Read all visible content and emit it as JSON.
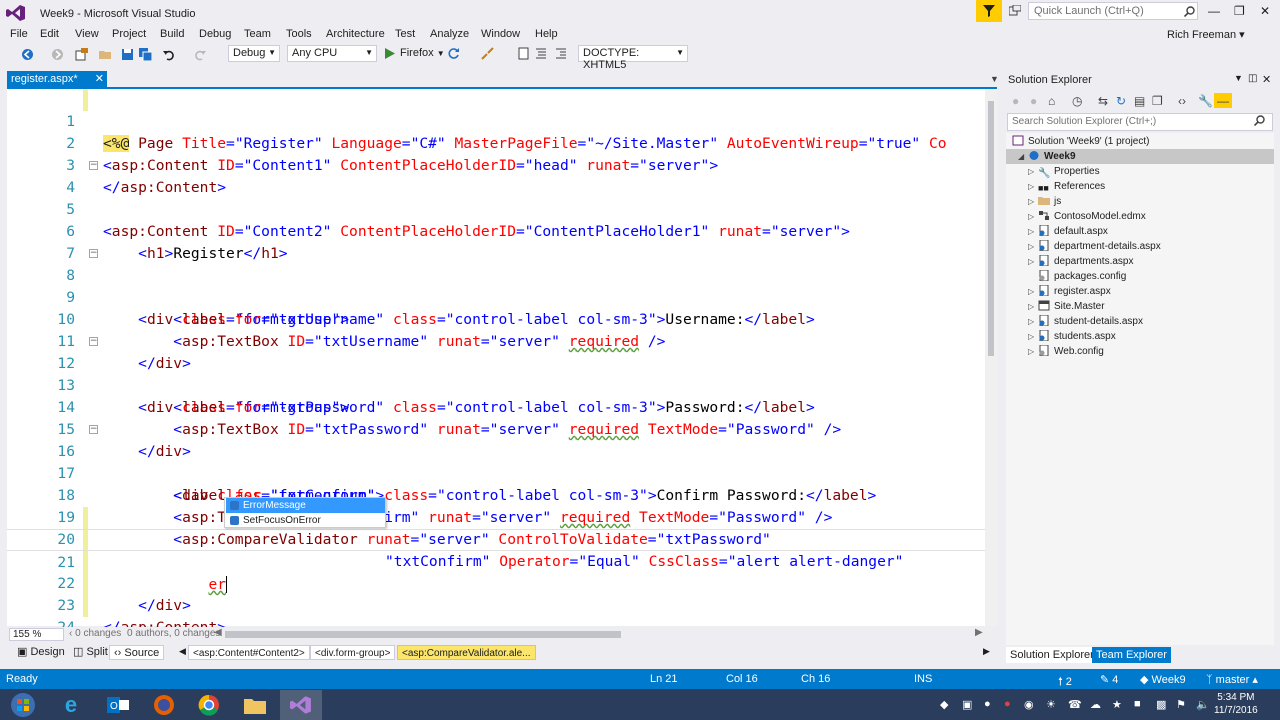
{
  "window": {
    "title": "Week9 - Microsoft Visual Studio",
    "quick_launch_placeholder": "Quick Launch (Ctrl+Q)",
    "user": "Rich Freeman"
  },
  "menu": [
    "File",
    "Edit",
    "View",
    "Project",
    "Build",
    "Debug",
    "Team",
    "Tools",
    "Architecture",
    "Test",
    "Analyze",
    "Window",
    "Help"
  ],
  "toolbar": {
    "config": "Debug",
    "platform": "Any CPU",
    "browser": "Firefox",
    "doctype": "DOCTYPE: XHTML5"
  },
  "editor": {
    "tab_label": "register.aspx*",
    "zoom": "155 %",
    "changes": "0 changes",
    "authors": "0 authors, 0 changes",
    "lines": [
      {
        "n": "1"
      },
      {
        "n": "2"
      },
      {
        "n": "3"
      },
      {
        "n": "4"
      },
      {
        "n": "5"
      },
      {
        "n": "6"
      },
      {
        "n": "7"
      },
      {
        "n": "8"
      },
      {
        "n": "9"
      },
      {
        "n": "10"
      },
      {
        "n": "11"
      },
      {
        "n": "12"
      },
      {
        "n": "13"
      },
      {
        "n": "14"
      },
      {
        "n": "15"
      },
      {
        "n": "16"
      },
      {
        "n": "17"
      },
      {
        "n": "18"
      },
      {
        "n": "19"
      },
      {
        "n": "20"
      },
      {
        "n": "21"
      },
      {
        "n": "22"
      },
      {
        "n": "23"
      },
      {
        "n": "24"
      }
    ],
    "code": {
      "l1": {
        "open": "<%@",
        "page": " Page ",
        "a1": "Title",
        "v1": "\"Register\"",
        "a2": " Language",
        "v2": "\"C#\"",
        "a3": " MasterPageFile",
        "v3": "\"~/Site.Master\"",
        "a4": " AutoEventWireup",
        "v4": "\"true\"",
        "a5": " Co"
      },
      "l2": {
        "t1": "<",
        "tag": "asp:Content",
        "a1": " ID",
        "v1": "\"Content1\"",
        "a2": " ContentPlaceHolderID",
        "v2": "\"head\"",
        "a3": " runat",
        "v3": "\"server\"",
        "t2": ">"
      },
      "l3": {
        "t1": "</",
        "tag": "asp:Content",
        "t2": ">"
      },
      "l4": {
        "t1": "<",
        "tag": "asp:Content",
        "a1": " ID",
        "v1": "\"Content2\"",
        "a2": " ContentPlaceHolderID",
        "v2": "\"ContentPlaceHolder1\"",
        "a3": " runat",
        "v3": "\"server\"",
        "t2": ">"
      },
      "l6": {
        "t1": "<",
        "tag": "h1",
        "t2": ">",
        "text": "Register",
        "t3": "</",
        "tag2": "h1",
        "t4": ">"
      },
      "l8": {
        "t1": "<",
        "tag": "div",
        "a1": " class",
        "v1": "\"form-group\"",
        "t2": ">"
      },
      "l9": {
        "t1": "<",
        "tag": "label",
        "a1": " for",
        "v1": "\"txtUsername\"",
        "a2": " class",
        "v2": "\"control-label col-sm-3\"",
        "t2": ">",
        "text": "Username:",
        "t3": "</",
        "tag2": "label",
        "t4": ">"
      },
      "l10": {
        "t1": "<",
        "tag": "asp:TextBox",
        "a1": " ID",
        "v1": "\"txtUsername\"",
        "a2": " runat",
        "v2": "\"server\"",
        "sp": " ",
        "req": "required",
        "t2": " />"
      },
      "l11": {
        "t1": "</",
        "tag": "div",
        "t2": ">"
      },
      "l12": {
        "t1": "<",
        "tag": "div",
        "a1": " class",
        "v1": "\"form-group\"",
        "t2": ">"
      },
      "l13": {
        "t1": "<",
        "tag": "label",
        "a1": " for",
        "v1": "\"txtPassword\"",
        "a2": " class",
        "v2": "\"control-label col-sm-3\"",
        "t2": ">",
        "text": "Password:",
        "t3": "</",
        "tag2": "label",
        "t4": ">"
      },
      "l14": {
        "t1": "<",
        "tag": "asp:TextBox",
        "a1": " ID",
        "v1": "\"txtPassword\"",
        "a2": " runat",
        "v2": "\"server\"",
        "sp": " ",
        "req": "required",
        "a3": " TextMode",
        "v3": "\"Password\"",
        "t2": " />"
      },
      "l15": {
        "t1": "</",
        "tag": "div",
        "t2": ">"
      },
      "l16": {
        "t1": "<",
        "tag": "div",
        "a1": " class",
        "v1": "\"form-group\"",
        "t2": ">"
      },
      "l17": {
        "t1": "<",
        "tag": "label",
        "a1": " for",
        "v1": "\"txtConfirm\"",
        "a2": " class",
        "v2": "\"control-label col-sm-3\"",
        "t2": ">",
        "text": "Confirm Password:",
        "t3": "</",
        "tag2": "label",
        "t4": ">"
      },
      "l18": {
        "t1": "<",
        "tag": "asp:TextBox",
        "a1": " ID",
        "v1": "\"txtConfirm\"",
        "a2": " runat",
        "v2": "\"server\"",
        "sp": " ",
        "req": "required",
        "a3": " TextMode",
        "v3": "\"Password\"",
        "t2": " />"
      },
      "l19": {
        "t1": "<",
        "tag": "asp:CompareValidator",
        "a1": " runat",
        "v1": "\"server\"",
        "a2": " ControlToValidate",
        "v2": "\"txtPassword\""
      },
      "l20": {
        "v1": "\"txtConfirm\"",
        "a1": " Operator",
        "v2": "\"Equal\"",
        "a2": " CssClass",
        "v3": "\"alert alert-danger\""
      },
      "l21": {
        "typed": "er"
      },
      "l22": {
        "t1": "</",
        "tag": "div",
        "t2": ">"
      },
      "l23": {
        "t1": "</",
        "tag": "asp:Content",
        "t2": ">"
      }
    },
    "intellisense": [
      "ErrorMessage",
      "SetFocusOnError"
    ]
  },
  "view_tabs": {
    "design": "Design",
    "split": "Split",
    "source": "Source",
    "breadcrumbs": [
      "<asp:Content#Content2>",
      "<div.form-group>",
      "<asp:CompareValidator.ale..."
    ]
  },
  "solution_explorer": {
    "title": "Solution Explorer",
    "search_placeholder": "Search Solution Explorer (Ctrl+;)",
    "solution": "Solution 'Week9' (1 project)",
    "project": "Week9",
    "items": [
      "Properties",
      "References",
      "js",
      "ContosoModel.edmx",
      "default.aspx",
      "department-details.aspx",
      "departments.aspx",
      "packages.config",
      "register.aspx",
      "Site.Master",
      "student-details.aspx",
      "students.aspx",
      "Web.config"
    ],
    "tab_active": "Solution Explorer",
    "tab_other": "Team Explorer"
  },
  "status": {
    "ready": "Ready",
    "ln": "Ln 21",
    "col": "Col 16",
    "ch": "Ch 16",
    "ins": "INS",
    "up": "2",
    "pencil": "4",
    "repo": "Week9",
    "branch": "master"
  },
  "taskbar": {
    "time": "5:34 PM",
    "date": "11/7/2016"
  }
}
